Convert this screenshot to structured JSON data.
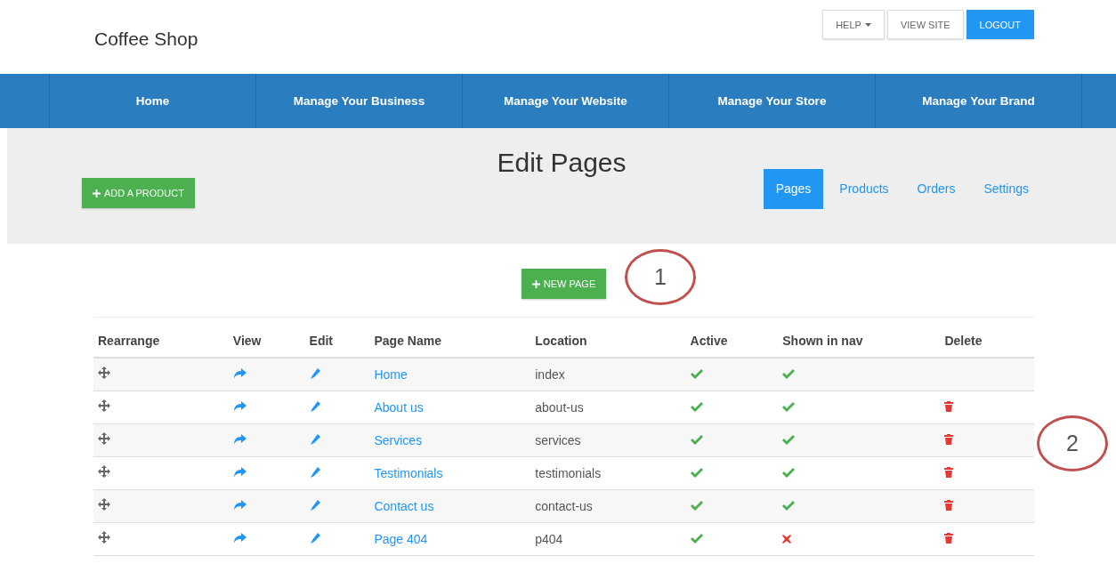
{
  "brand": "Coffee Shop",
  "top_buttons": [
    {
      "label": "HELP",
      "kind": "dropdown",
      "primary": false
    },
    {
      "label": "VIEW SITE",
      "kind": "plain",
      "primary": false
    },
    {
      "label": "LOGOUT",
      "kind": "plain",
      "primary": true
    }
  ],
  "nav": [
    "Home",
    "Manage Your Business",
    "Manage Your Website",
    "Manage Your Store",
    "Manage Your Brand"
  ],
  "title": "Edit Pages",
  "add_button": "ADD A PRODUCT",
  "tabs": [
    {
      "label": "Pages",
      "selected": true
    },
    {
      "label": "Products",
      "selected": false
    },
    {
      "label": "Orders",
      "selected": false
    },
    {
      "label": "Settings",
      "selected": false
    }
  ],
  "new_page_button": "NEW PAGE",
  "annotations": [
    {
      "label": "1"
    },
    {
      "label": "2"
    }
  ],
  "table": {
    "columns": [
      "Rearrange",
      "View",
      "Edit",
      "Page Name",
      "Location",
      "Active",
      "Shown in nav",
      "Delete"
    ],
    "rows": [
      {
        "name": "Home",
        "location": "index",
        "active": true,
        "shown": true,
        "deletable": false
      },
      {
        "name": "About us",
        "location": "about-us",
        "active": true,
        "shown": true,
        "deletable": true
      },
      {
        "name": "Services",
        "location": "services",
        "active": true,
        "shown": true,
        "deletable": true
      },
      {
        "name": "Testimonials",
        "location": "testimonials",
        "active": true,
        "shown": true,
        "deletable": true
      },
      {
        "name": "Contact us",
        "location": "contact-us",
        "active": true,
        "shown": true,
        "deletable": true
      },
      {
        "name": "Page 404",
        "location": "p404",
        "active": true,
        "shown": false,
        "deletable": true
      }
    ]
  }
}
